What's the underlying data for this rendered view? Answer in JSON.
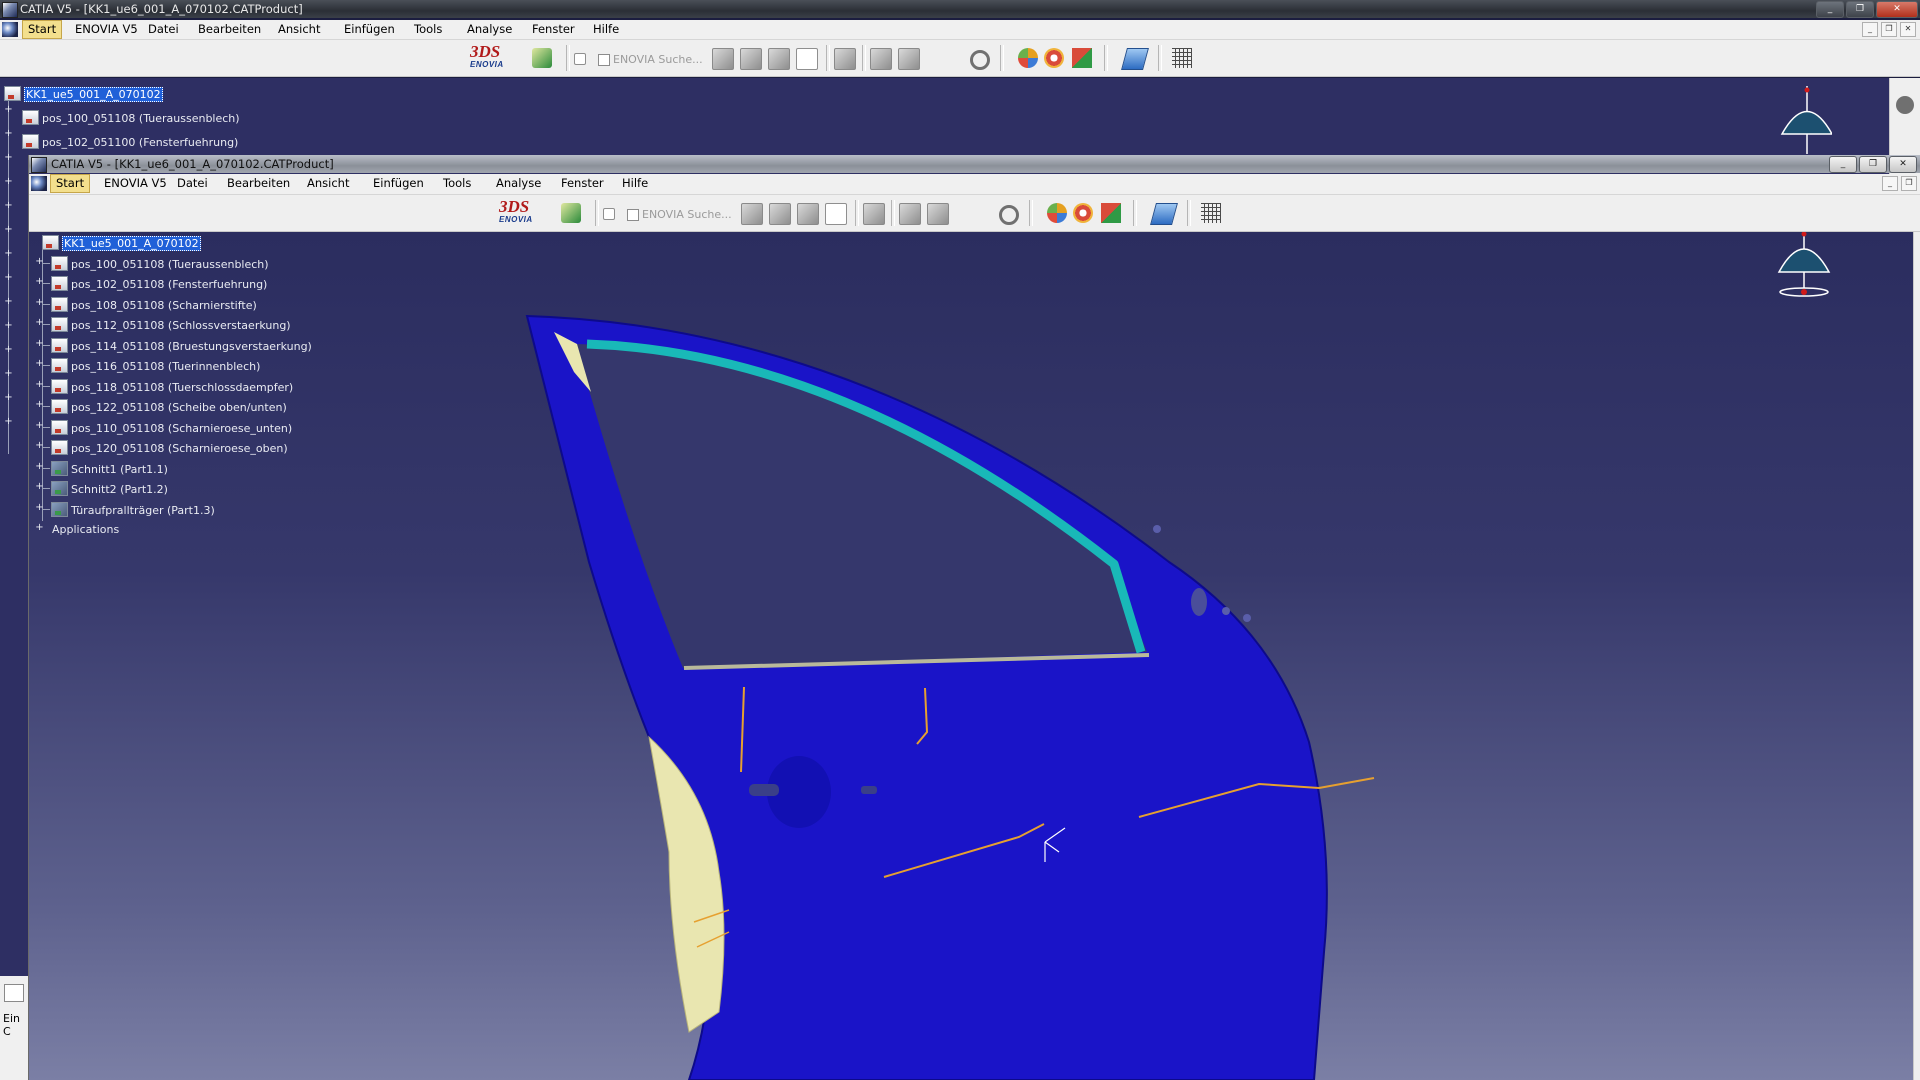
{
  "back_window": {
    "title": "CATIA V5 - [KK1_ue6_001_A_070102.CATProduct]",
    "tree": [
      {
        "label": "KK1_ue5_001_A_070102",
        "root": true
      },
      {
        "label": "pos_100_051108 (Tueraussenblech)"
      },
      {
        "label": "pos_102_051100 (Fensterfuehrung)"
      }
    ],
    "status_text": "Ein C"
  },
  "front_window": {
    "title": "CATIA V5 - [KK1_ue6_001_A_070102.CATProduct]",
    "tree": [
      {
        "label": "KK1_ue5_001_A_070102",
        "root": true
      },
      {
        "label": "pos_100_051108 (Tueraussenblech)"
      },
      {
        "label": "pos_102_051108 (Fensterfuehrung)"
      },
      {
        "label": "pos_108_051108 (Scharnierstifte)"
      },
      {
        "label": "pos_112_051108 (Schlossverstaerkung)"
      },
      {
        "label": "pos_114_051108 (Bruestungsverstaerkung)"
      },
      {
        "label": "pos_116_051108 (Tuerinnenblech)"
      },
      {
        "label": "pos_118_051108 (Tuerschlossdaempfer)"
      },
      {
        "label": "pos_122_051108 (Scheibe oben/unten)"
      },
      {
        "label": "pos_110_051108 (Scharnieroese_unten)"
      },
      {
        "label": "pos_120_051108 (Scharnieroese_oben)"
      },
      {
        "label": "Schnitt1 (Part1.1)",
        "type": "part"
      },
      {
        "label": "Schnitt2 (Part1.2)",
        "type": "part"
      },
      {
        "label": "Türaufprallträger (Part1.3)",
        "type": "part"
      },
      {
        "label": "Applications",
        "type": "app"
      }
    ]
  },
  "menu": {
    "items": [
      "Start",
      "ENOVIA V5",
      "Datei",
      "Bearbeiten",
      "Ansicht",
      "Einfügen",
      "Tools",
      "Analyse",
      "Fenster",
      "Hilfe"
    ],
    "active": "Start"
  },
  "toolbar": {
    "logo_text": "3DS",
    "logo_sub": "ENOVIA",
    "search_label": "ENOVIA Suche..."
  },
  "window_buttons": {
    "minimize": "_",
    "restore": "❐",
    "close": "✕"
  },
  "colors": {
    "viewport_top": "#2a2c5e",
    "viewport_bottom": "#7a7fa6",
    "door_panel": "#1a14c8",
    "window_frame": "#19b8b8",
    "inner_panel": "#e9e6b0",
    "selection": "#2060d8"
  },
  "icons": [
    "enovia-logo-icon",
    "navigate-icon",
    "search-checkbox-icon",
    "grid-icon",
    "spiral-icon",
    "render-icon",
    "multi-view-icon",
    "blue-plane-icon",
    "snap-grid-icon"
  ]
}
